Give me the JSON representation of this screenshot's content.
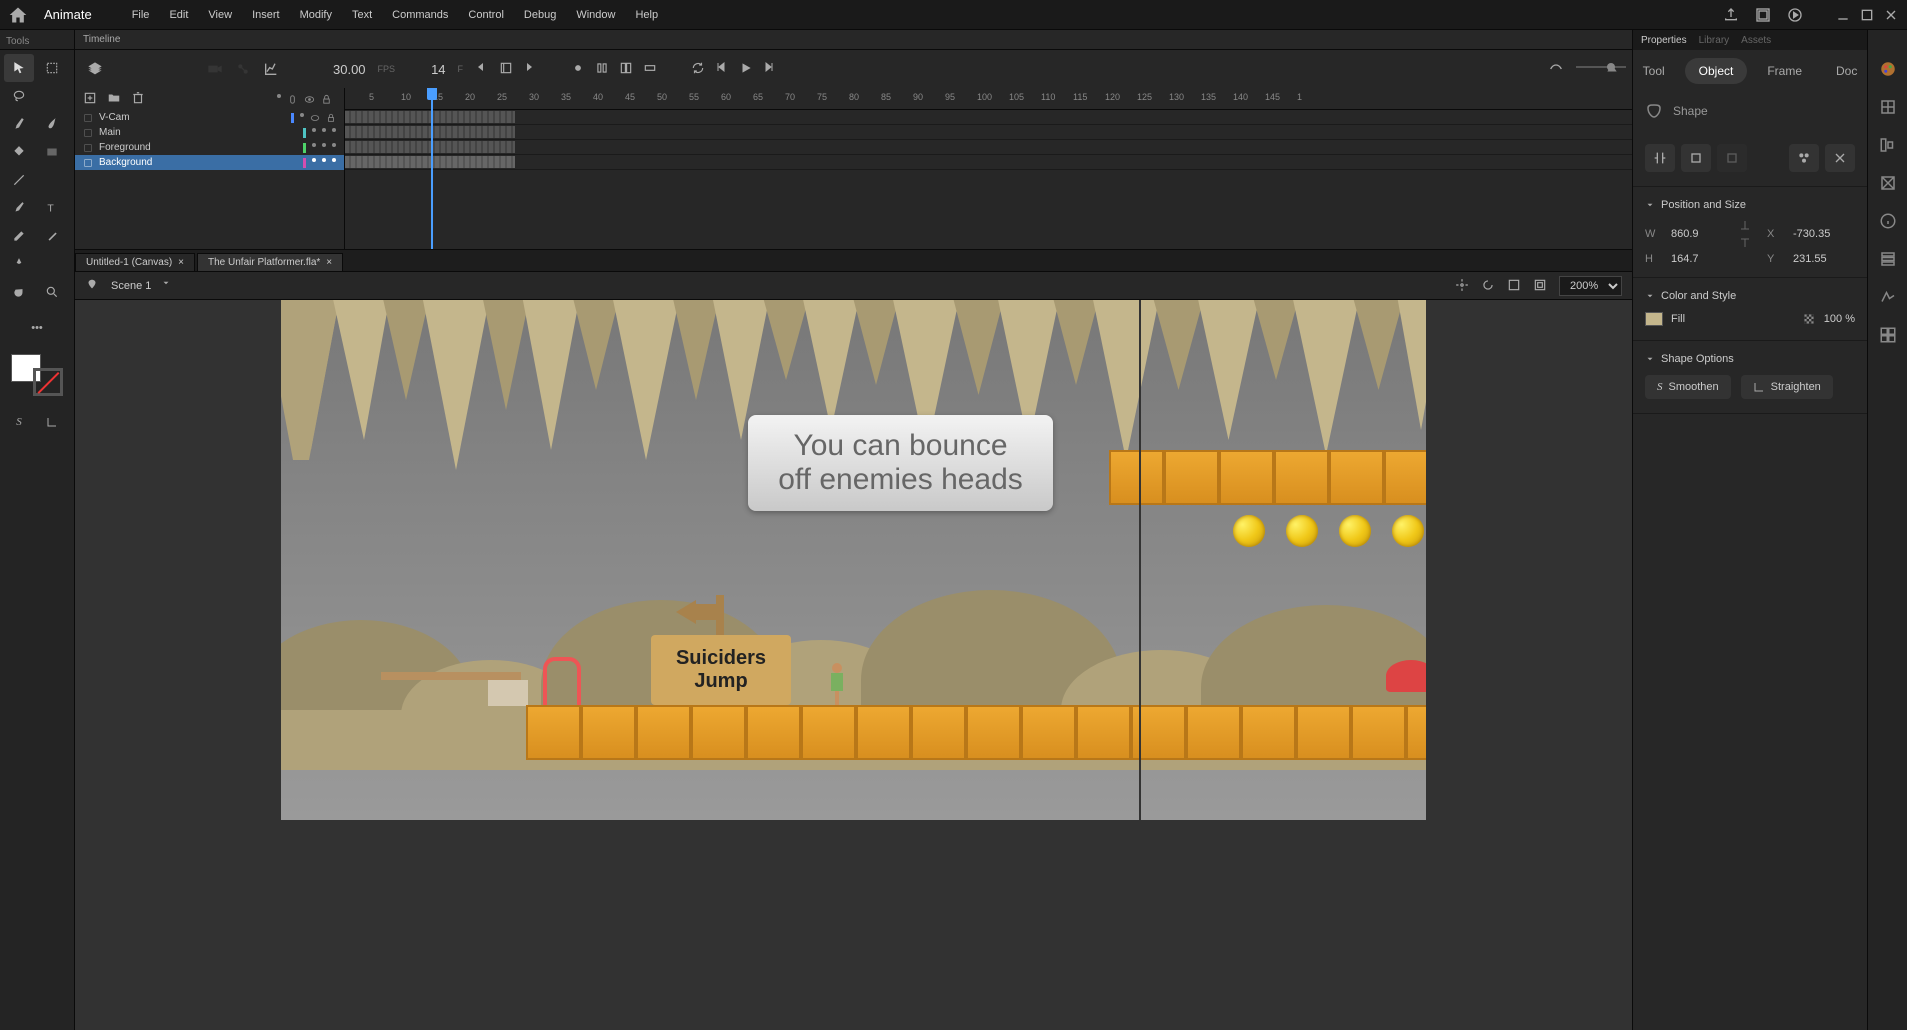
{
  "app": {
    "name": "Animate"
  },
  "menu": [
    "File",
    "Edit",
    "View",
    "Insert",
    "Modify",
    "Text",
    "Commands",
    "Control",
    "Debug",
    "Window",
    "Help"
  ],
  "tools_label": "Tools",
  "timeline": {
    "label": "Timeline",
    "fps": "30.00",
    "fps_label": "FPS",
    "frame": "14",
    "frame_label": "F",
    "ruler": [
      "5",
      "10",
      "15",
      "20",
      "25",
      "30",
      "35",
      "40",
      "45",
      "50",
      "55",
      "60",
      "65",
      "70",
      "75",
      "80",
      "85",
      "90",
      "95",
      "100",
      "105",
      "110",
      "115",
      "120",
      "125",
      "130",
      "135",
      "140",
      "145",
      "1"
    ],
    "layers": [
      {
        "name": "V-Cam",
        "color": "#4a88ff",
        "selected": false
      },
      {
        "name": "Main",
        "color": "#4ec4c4",
        "selected": false
      },
      {
        "name": "Foreground",
        "color": "#4ed46a",
        "selected": false
      },
      {
        "name": "Background",
        "color": "#d44eb0",
        "selected": true
      }
    ]
  },
  "tabs": [
    {
      "label": "Untitled-1 (Canvas)",
      "active": false
    },
    {
      "label": "The Unfair Platformer.fla*",
      "active": true
    }
  ],
  "scene": {
    "name": "Scene 1",
    "zoom": "200%"
  },
  "stage": {
    "sign_text": "Suiciders Jump",
    "tooltip": "You can bounce off enemies heads"
  },
  "properties": {
    "panel_tabs": [
      "Properties",
      "Library",
      "Assets"
    ],
    "tabs": [
      "Tool",
      "Object",
      "Frame",
      "Doc"
    ],
    "type": "Shape",
    "pos_size_label": "Position and Size",
    "W_label": "W",
    "W": "860.9",
    "H_label": "H",
    "H": "164.7",
    "X_label": "X",
    "X": "-730.35",
    "Y_label": "Y",
    "Y": "231.55",
    "color_style_label": "Color and Style",
    "fill_label": "Fill",
    "fill_pct": "100 %",
    "shape_opts_label": "Shape Options",
    "smoothen": "Smoothen",
    "straighten": "Straighten"
  }
}
